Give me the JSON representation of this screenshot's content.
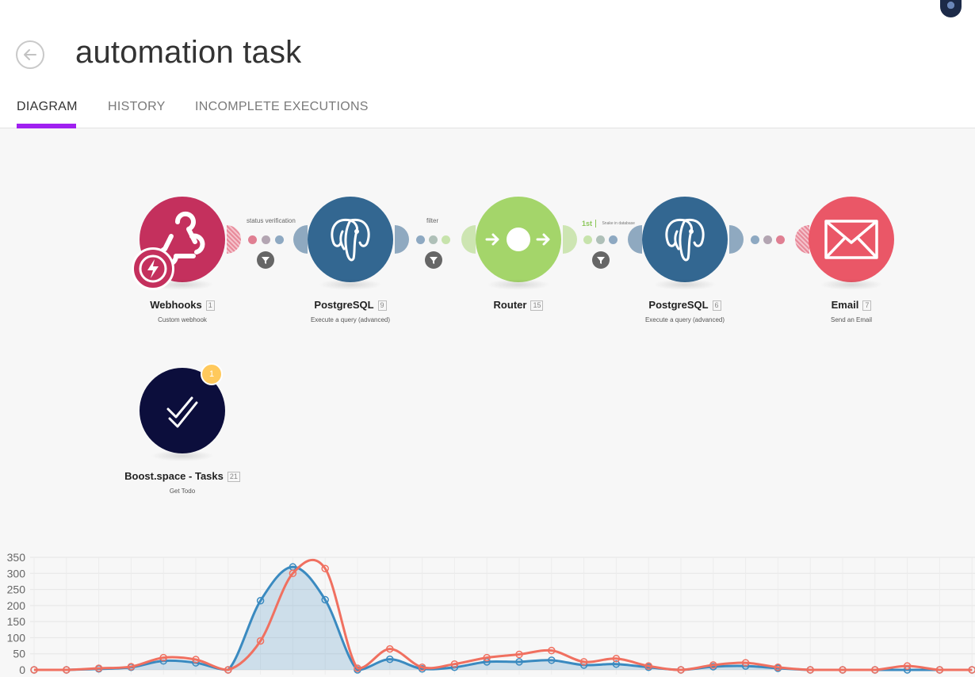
{
  "header": {
    "title": "automation task"
  },
  "tabs": [
    {
      "label": "DIAGRAM"
    },
    {
      "label": "HISTORY"
    },
    {
      "label": "INCOMPLETE EXECUTIONS"
    }
  ],
  "modules": [
    {
      "name": "Webhooks",
      "id": "1",
      "subtitle": "Custom webhook",
      "color": "#c4305d",
      "icon": "webhook-icon"
    },
    {
      "name": "PostgreSQL",
      "id": "9",
      "subtitle": "Execute a query (advanced)",
      "color": "#336791",
      "icon": "postgresql-elephant-icon"
    },
    {
      "name": "Router",
      "id": "15",
      "subtitle": "",
      "color": "#a4d56a",
      "icon": "router-icon"
    },
    {
      "name": "PostgreSQL",
      "id": "6",
      "subtitle": "Execute a query (advanced)",
      "color": "#336791",
      "icon": "postgresql-elephant-icon"
    },
    {
      "name": "Email",
      "id": "7",
      "subtitle": "Send an Email",
      "color": "#ea5767",
      "icon": "envelope-icon"
    },
    {
      "name": "Boost.space - Tasks",
      "id": "21",
      "subtitle": "Get Todo",
      "color": "#0c0e3c",
      "icon": "double-check-icon",
      "badge": "1"
    }
  ],
  "links": [
    {
      "label": "status verification"
    },
    {
      "label": "filter"
    },
    {
      "label": "Snake in database",
      "order": "1st"
    }
  ],
  "chart_data": {
    "type": "area",
    "y_ticks": [
      0,
      50,
      100,
      150,
      200,
      250,
      300,
      350
    ],
    "ylim": [
      0,
      350
    ],
    "grid": true,
    "series": [
      {
        "color": "#3a8ac0",
        "values": [
          0,
          0,
          3,
          8,
          28,
          22,
          0,
          215,
          320,
          218,
          0,
          33,
          3,
          8,
          25,
          25,
          30,
          15,
          18,
          8,
          0,
          10,
          12,
          5,
          0,
          0,
          0,
          0,
          0,
          0
        ]
      },
      {
        "color": "#f07060",
        "values": [
          0,
          0,
          5,
          10,
          38,
          32,
          0,
          90,
          300,
          315,
          5,
          65,
          8,
          18,
          38,
          48,
          60,
          25,
          35,
          12,
          0,
          15,
          22,
          8,
          0,
          0,
          0,
          12,
          0,
          0
        ]
      }
    ]
  }
}
